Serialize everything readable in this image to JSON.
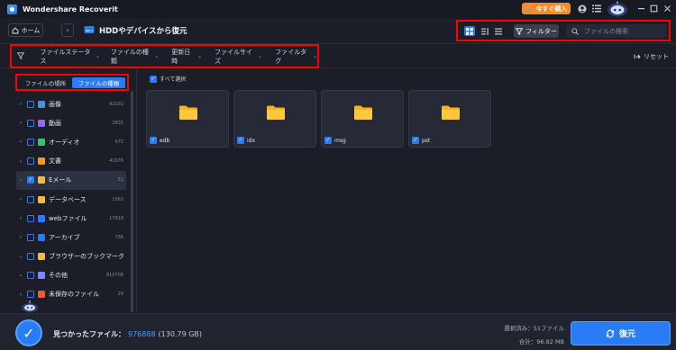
{
  "app": {
    "title": "Wondershare Recoverit"
  },
  "titlebar": {
    "buy_label": "今すぐ購入",
    "window_controls": [
      "minimize-icon",
      "maximize-icon",
      "close-icon"
    ]
  },
  "header": {
    "home_label": "ホーム",
    "path_title": "HDDやデバイスから復元",
    "filter_label": "フィルター",
    "search_placeholder": "ファイルの検索",
    "view_modes": [
      "grid-view-icon",
      "list-view-icon",
      "detail-view-icon"
    ],
    "active_view": "grid-view-icon"
  },
  "filterbar": {
    "items": [
      {
        "label": "ファイルステータス"
      },
      {
        "label": "ファイルの種類"
      },
      {
        "label": "更新日時"
      },
      {
        "label": "ファイルサイズ"
      },
      {
        "label": "ファイルタグ"
      }
    ],
    "reset_label": "リセット"
  },
  "sidebar": {
    "segments": [
      {
        "label": "ファイルの場所",
        "active": false
      },
      {
        "label": "ファイルの種類",
        "active": true
      }
    ],
    "tree": [
      {
        "label": "画像",
        "count": "92192",
        "color": "#4a90e2",
        "checked": false,
        "selected": false
      },
      {
        "label": "動画",
        "count": "2835",
        "color": "#8e6cf0",
        "checked": false,
        "selected": false
      },
      {
        "label": "オーディオ",
        "count": "675",
        "color": "#3bbf6a",
        "checked": false,
        "selected": false
      },
      {
        "label": "文書",
        "count": "41676",
        "color": "#f09a2a",
        "checked": false,
        "selected": false
      },
      {
        "label": "Eメール",
        "count": "51",
        "color": "#f4b942",
        "checked": true,
        "selected": true
      },
      {
        "label": "データベース",
        "count": "1062",
        "color": "#f4b942",
        "checked": false,
        "selected": false
      },
      {
        "label": "webファイル",
        "count": "17918",
        "color": "#2a7bf6",
        "checked": false,
        "selected": false
      },
      {
        "label": "アーカイブ",
        "count": "736",
        "color": "#2a7bf6",
        "checked": false,
        "selected": false
      },
      {
        "label": "ブラウザーのブックマーク",
        "count": "4",
        "color": "#f4b942",
        "checked": false,
        "selected": false
      },
      {
        "label": "その他",
        "count": "819708",
        "color": "#7a86ff",
        "checked": false,
        "selected": false
      },
      {
        "label": "未保存のファイル",
        "count": "29",
        "color": "#e85c3f",
        "checked": false,
        "selected": false
      }
    ]
  },
  "main": {
    "select_all_label": "すべて選択",
    "folders": [
      {
        "name": "edb"
      },
      {
        "name": "idx"
      },
      {
        "name": "msg"
      },
      {
        "name": "pst"
      }
    ]
  },
  "footer": {
    "found_label": "見つかったファイル：",
    "found_count": "976888",
    "found_size": "(130.79 GB)",
    "selected_text": "選択済み：51ファイル",
    "total_text": "合計：96.82 MB",
    "recover_label": "復元"
  }
}
